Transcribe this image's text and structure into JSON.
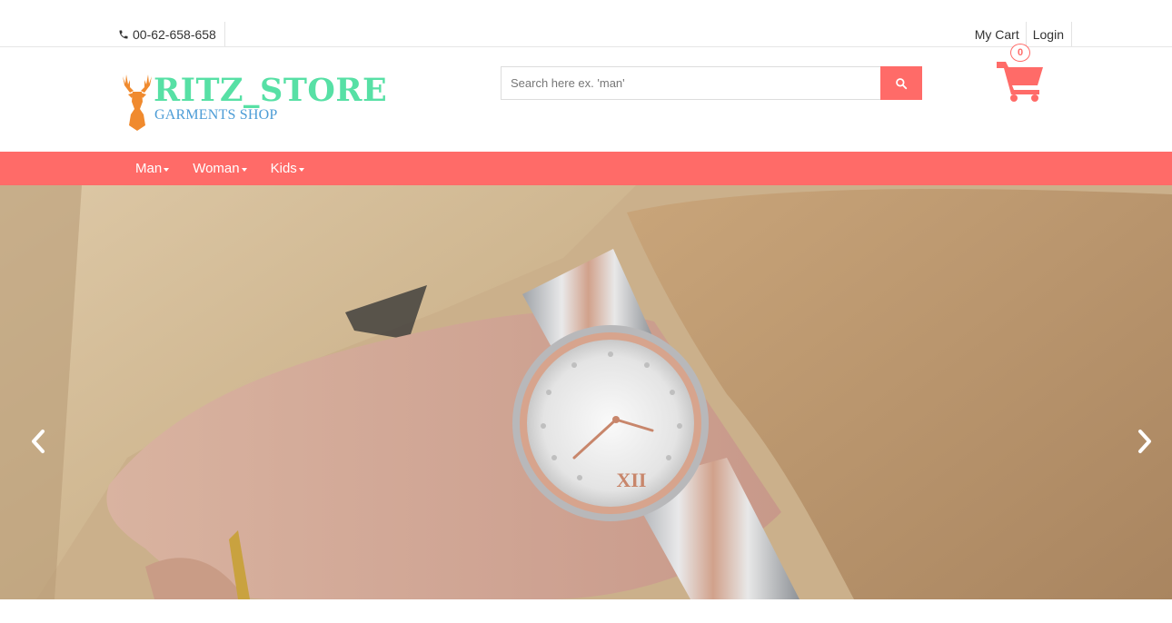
{
  "topbar": {
    "phone": "00-62-658-658",
    "links": [
      "My Cart",
      "Login"
    ]
  },
  "logo": {
    "brand": "RITZ_STORE",
    "tagline": "GARMENTS SHOP"
  },
  "search": {
    "placeholder": "Search here ex. 'man'",
    "value": ""
  },
  "cart": {
    "count": "0"
  },
  "nav": {
    "items": [
      "Man",
      "Woman",
      "Kids"
    ]
  },
  "colors": {
    "accent": "#ff6b68",
    "brand_green": "#57e0a5",
    "tagline_blue": "#4c9cd6",
    "logo_orange": "#f08a2e"
  },
  "icons": {
    "phone": "phone-icon",
    "search": "search-icon",
    "cart": "cart-icon",
    "prev": "chevron-left-icon",
    "next": "chevron-right-icon"
  }
}
